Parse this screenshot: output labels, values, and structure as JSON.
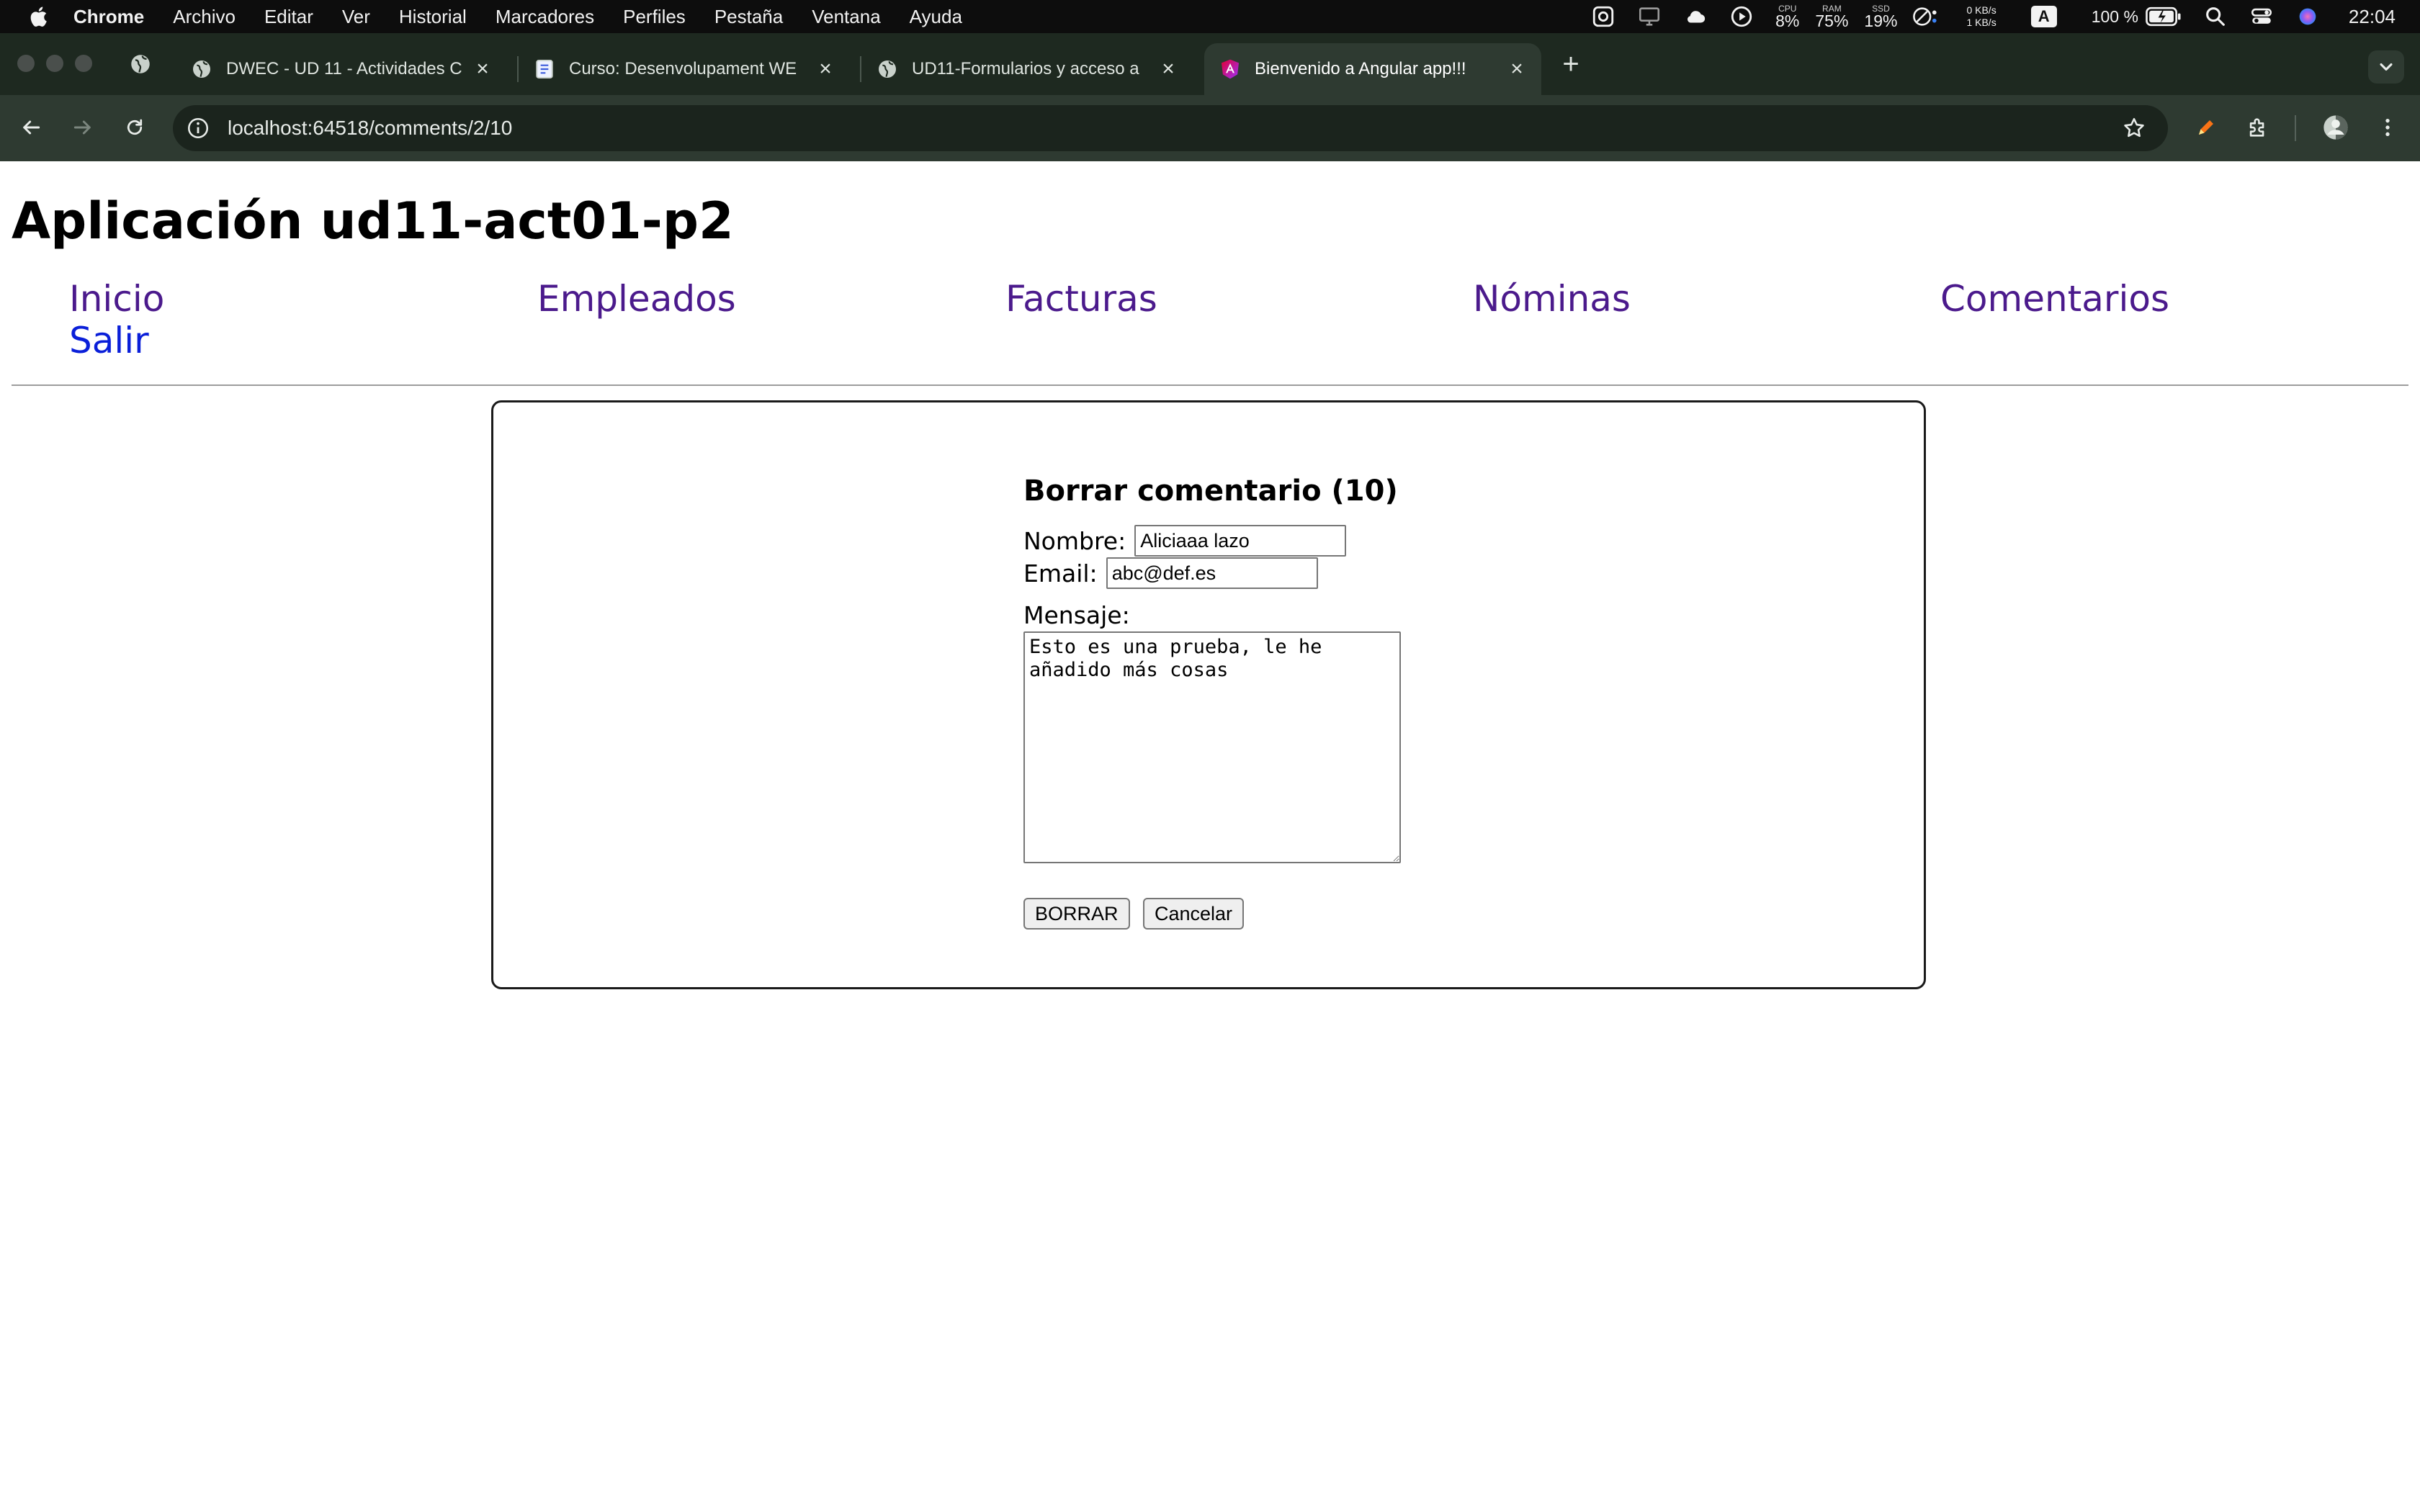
{
  "menubar": {
    "app_name": "Chrome",
    "items": [
      "Archivo",
      "Editar",
      "Ver",
      "Historial",
      "Marcadores",
      "Perfiles",
      "Pestaña",
      "Ventana",
      "Ayuda"
    ],
    "cpu_label": "CPU",
    "cpu_value": "8%",
    "ram_label": "RAM",
    "ram_value": "75%",
    "ssd_label": "SSD",
    "ssd_value": "19%",
    "net_down": "0 KB/s",
    "net_up": "1 KB/s",
    "input_source": "A",
    "battery": "100 %",
    "clock": "22:04"
  },
  "tabs": [
    {
      "title": "DWEC - UD 11 - Actividades C",
      "favicon": "globe-icon"
    },
    {
      "title": "Curso: Desenvolupament WE",
      "favicon": "document-icon"
    },
    {
      "title": "UD11-Formularios y acceso a",
      "favicon": "globe-icon"
    },
    {
      "title": "Bienvenido a Angular app!!!",
      "favicon": "angular-icon",
      "active": true
    }
  ],
  "toolbar": {
    "url": "localhost:64518/comments/2/10"
  },
  "page": {
    "title": "Aplicación ud11-act01-p2",
    "nav": [
      "Inicio",
      "Empleados",
      "Facturas",
      "Nóminas",
      "Comentarios",
      "Salir"
    ],
    "form": {
      "heading": "Borrar comentario (10)",
      "name_label": "Nombre:",
      "name_value": "Aliciaaa lazo",
      "email_label": "Email:",
      "email_value": "abc@def.es",
      "message_label": "Mensaje:",
      "message_value": "Esto es una prueba, le he\nañadido más cosas",
      "delete_label": "BORRAR",
      "cancel_label": "Cancelar"
    }
  },
  "colors": {
    "menubar_bg": "#0d0d0d",
    "tabstrip_bg": "#1e2920",
    "toolbar_bg": "#2e3a31",
    "visited_link": "#4b1a8c",
    "link": "#0a1fd9"
  }
}
